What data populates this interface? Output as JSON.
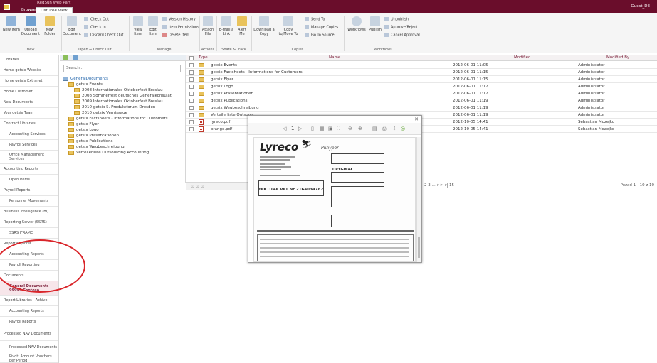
{
  "app": {
    "brand": "RedSun Web Part",
    "user": "Guest_DE"
  },
  "top_tabs": [
    {
      "label": "Browse"
    },
    {
      "label": "List Tree View"
    }
  ],
  "ribbon": {
    "new_item": "New Item",
    "upload_document": "Upload Document",
    "new_folder": "New Folder",
    "edit_document": "Edit Document",
    "check_out": "Check Out",
    "check_in": "Check In",
    "discard_check_out": "Discard Check Out",
    "view_item": "View Item",
    "edit_item": "Edit Item",
    "version_history": "Version History",
    "item_permissions": "Item Permissions",
    "delete_item": "Delete Item",
    "attach_file": "Attach File",
    "email_link": "E-mail a Link",
    "alert_me": "Alert Me",
    "download_copy": "Download a Copy",
    "copy_to_move_to": "Copy to/Move To",
    "send_to": "Send To",
    "manage_copies": "Manage Copies",
    "go_to_source": "Go To Source",
    "workflows": "Workflows",
    "publish": "Publish",
    "unpublish": "Unpublish",
    "approve_reject": "Approve/Reject",
    "cancel_approval": "Cancel Approval",
    "groups": [
      "New",
      "Open & Check Out",
      "Manage",
      "Actions",
      "Share & Track",
      "Copies",
      "Workflows"
    ]
  },
  "leftnav": [
    {
      "label": "Libraries"
    },
    {
      "label": "Home getsix Website"
    },
    {
      "label": "Home getsix Extranet"
    },
    {
      "label": "Home Customer"
    },
    {
      "label": "New Documents"
    },
    {
      "label": "Your getsix Team"
    },
    {
      "label": "Contract Libraries"
    },
    {
      "label": "Accounting Services"
    },
    {
      "label": "Payroll Services"
    },
    {
      "label": "Office Management Services"
    },
    {
      "label": "Accounting Reports"
    },
    {
      "label": "Open Items"
    },
    {
      "label": "Payroll Reports"
    },
    {
      "label": "Personnel Movements"
    },
    {
      "label": "Business Intelligence (BI)"
    },
    {
      "label": "Reporting Server (SSRS)"
    },
    {
      "label": "SSRS IFRAME"
    },
    {
      "label": "Report Explorer"
    },
    {
      "label": "Accounting Reports"
    },
    {
      "label": "Payroll Reporting"
    },
    {
      "label": "Documents"
    },
    {
      "label": "General Documents 99999 Contoso"
    },
    {
      "label": "Report Libraries - Achive"
    },
    {
      "label": "Accounting Reports"
    },
    {
      "label": "Payroll Reports"
    },
    {
      "label": "Processed NAV Documents"
    },
    {
      "label": "Processed NAV Documents"
    },
    {
      "label": "Pivot: Amount Vouchers per Period"
    }
  ],
  "tree": {
    "search_placeholder": "Search...",
    "nodes": [
      {
        "label": "GeneralDocuments"
      },
      {
        "label": "getsix Events"
      },
      {
        "label": "2008 Internationales Oktoberfest Breslau"
      },
      {
        "label": "2008 Sommerfest deutsches Generalkonsulat"
      },
      {
        "label": "2009 Internationales Oktoberfest Breslau"
      },
      {
        "label": "2010 getsix 5. Produktforum Dresden"
      },
      {
        "label": "2010 getsix Vernissage"
      },
      {
        "label": "getsix Factsheets - Informations for Customers"
      },
      {
        "label": "getsix Flyer"
      },
      {
        "label": "getsix Logo"
      },
      {
        "label": "getsix Präsentationen"
      },
      {
        "label": "getsix Publications"
      },
      {
        "label": "getsix Wegbeschreibung"
      },
      {
        "label": "Verteilerliste Outsourcing Accounting"
      }
    ]
  },
  "grid": {
    "columns": {
      "type": "Type",
      "name": "Name",
      "modified": "Modified",
      "modified_by": "Modified By"
    },
    "rows": [
      {
        "name": "getsix Events",
        "modified": "2012-06-01 11:05",
        "by": "Administrator",
        "kind": "folder"
      },
      {
        "name": "getsix Factsheets - Informations for Customers",
        "modified": "2012-06-01 11:15",
        "by": "Administrator",
        "kind": "folder"
      },
      {
        "name": "getsix Flyer",
        "modified": "2012-06-01 11:15",
        "by": "Administrator",
        "kind": "folder"
      },
      {
        "name": "getsix Logo",
        "modified": "2012-06-01 11:17",
        "by": "Administrator",
        "kind": "folder"
      },
      {
        "name": "getsix Präsentationen",
        "modified": "2012-06-01 11:17",
        "by": "Administrator",
        "kind": "folder"
      },
      {
        "name": "getsix Publications",
        "modified": "2012-06-01 11:19",
        "by": "Administrator",
        "kind": "folder"
      },
      {
        "name": "getsix Wegbeschreibung",
        "modified": "2012-06-01 11:19",
        "by": "Administrator",
        "kind": "folder"
      },
      {
        "name": "Verteilerliste Outsourc",
        "modified": "2012-06-01 11:19",
        "by": "Administrator",
        "kind": "folder"
      },
      {
        "name": "lyreco.pdf",
        "modified": "2012-10-05 14:41",
        "by": "Sebastian Mozejko",
        "kind": "pdf"
      },
      {
        "name": "orange.pdf",
        "modified": "2012-10-05 14:41",
        "by": "Sebastian Mozejko",
        "kind": "pdf"
      }
    ],
    "pager_pages": "2 3 ... >> >|",
    "page_size": "15",
    "pager_summary": "Pozad 1 - 10 z 10"
  },
  "preview": {
    "page_nav": "1",
    "doc_company": "Lyreco",
    "doc_original": "ORYGINAŁ",
    "doc_invoice": "FAKTURA VAT Nr 2164034782"
  },
  "colors": {
    "brand": "#6a0d2b",
    "accent": "#7a1c37",
    "annotation": "#d9252a"
  }
}
